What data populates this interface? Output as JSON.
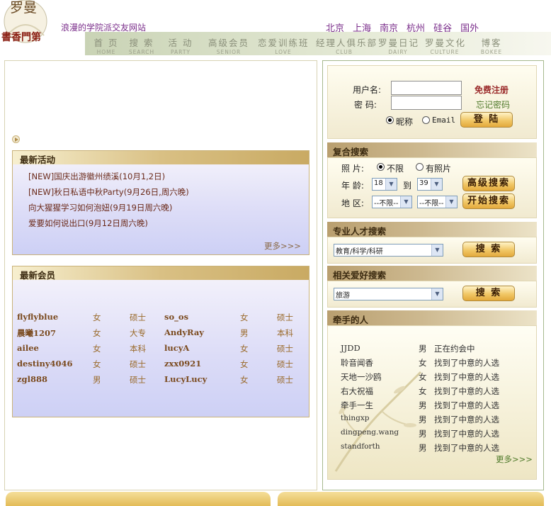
{
  "logo": {
    "line1": "罗曼",
    "line2": "書香門第"
  },
  "tagline": "浪漫的学院派交友网站",
  "cities": [
    "北京",
    "上海",
    "南京",
    "杭州",
    "硅谷",
    "国外"
  ],
  "nav": [
    {
      "cn": "首 页",
      "en": "HOME"
    },
    {
      "cn": "搜 索",
      "en": "SEARCH"
    },
    {
      "cn": "活 动",
      "en": "PARTY"
    },
    {
      "cn": "高级会员",
      "en": "SENIOR"
    },
    {
      "cn": "恋爱训练班",
      "en": "LOVE"
    },
    {
      "cn": "经理人俱乐部",
      "en": "CLUB"
    },
    {
      "cn": "罗曼日记",
      "en": "DAIRY"
    },
    {
      "cn": "罗曼文化",
      "en": "CULTURE"
    },
    {
      "cn": "博客",
      "en": "BOKEE"
    }
  ],
  "activities": {
    "title": "最新活动",
    "items": [
      "[NEW]国庆出游徽州绩溪(10月1,2日)",
      "[NEW]秋日私语中秋Party(9月26日,周六晚)",
      "向大猩猩学习如何泡妞(9月19日周六晚)",
      "爱要如何说出口(9月12日周六晚)"
    ],
    "more": "更多>>>"
  },
  "members": {
    "title": "最新会员",
    "rows": [
      [
        "flyflyblue",
        "女",
        "硕士",
        "so_os",
        "女",
        "硕士"
      ],
      [
        "晨曦1207",
        "女",
        "大专",
        "AndyRay",
        "男",
        "本科"
      ],
      [
        "ailee",
        "女",
        "本科",
        "lucyA",
        "女",
        "硕士"
      ],
      [
        "destiny4046",
        "女",
        "硕士",
        "zxx0921",
        "女",
        "硕士"
      ],
      [
        "zgl888",
        "男",
        "硕士",
        "LucyLucy",
        "女",
        "硕士"
      ]
    ]
  },
  "login": {
    "user_label": "用户名:",
    "pass_label": "密  码:",
    "register": "免费注册",
    "forgot": "忘记密码",
    "opt_nick": "昵称",
    "opt_email": "Email",
    "submit": "登 陆"
  },
  "search": {
    "title": "复合搜索",
    "photo_label": "照 片:",
    "photo_any": "不限",
    "photo_yes": "有照片",
    "age_label": "年 龄:",
    "age_from": "18",
    "age_to_label": "到",
    "age_to": "39",
    "area_label": "地 区:",
    "area1": "--不限--",
    "area2": "--不限--",
    "advanced": "高级搜索",
    "start": "开始搜索"
  },
  "talent": {
    "title": "专业人才搜索",
    "value": "教育/科学/科研",
    "button": "搜 索"
  },
  "hobby": {
    "title": "相关爱好搜索",
    "value": "旅游",
    "button": "搜 索"
  },
  "handinhand": {
    "title": "牵手的人",
    "rows": [
      [
        "JJDD",
        "男",
        "正在约会中"
      ],
      [
        "聆音闻香",
        "女",
        "找到了中意的人选"
      ],
      [
        "天地一沙鸥",
        "女",
        "找到了中意的人选"
      ],
      [
        "右大祝福",
        "女",
        "找到了中意的人选"
      ],
      [
        "牵手一生",
        "男",
        "找到了中意的人选"
      ],
      [
        "thingxp",
        "男",
        "找到了中意的人选"
      ],
      [
        "dingpeng.wang",
        "男",
        "找到了中意的人选"
      ],
      [
        "standforth",
        "男",
        "找到了中意的人选"
      ]
    ],
    "more": "更多>>>"
  },
  "colors": {
    "accent": "#c9aa63",
    "link": "#7a2d8a",
    "register": "#9b2b2b",
    "forgot": "#4f7a2a"
  }
}
